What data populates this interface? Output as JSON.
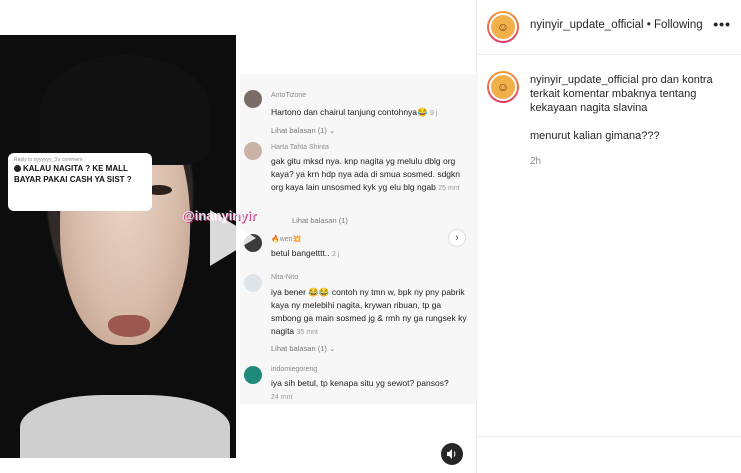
{
  "video": {
    "reply_meta": "Reply to nyyyyyy_3's comment",
    "reply_text": "KALAU NAGITA ? KE MALL BAYAR PAKAI CASH YA SIST ?",
    "watermark": "@inanyinyir"
  },
  "comments": [
    {
      "user": "AntoTizone",
      "text": "Hartono dan chairul tanjung contohnya😂",
      "time": "9 j",
      "link": "Lihat balasan (1)",
      "avatar_color": "#7a6b66"
    },
    {
      "user": "Harta Tahta Shinta",
      "text": "gak gitu mksd nya. knp nagita yg melulu dblg org kaya? ya krn hdp nya ada di smua sosmed. sdgkn org kaya lain unsosmed kyk yg elu blg ngab",
      "time": "25 mnt",
      "link": "",
      "avatar_color": "#c9b3a6"
    },
    {
      "user": "🔥wen💥",
      "text": "betul bangetttt..",
      "time": "2 j",
      "link": "Lihat balasan (1)",
      "avatar_color": "#3b3b3b"
    },
    {
      "user": "Nita-Nito",
      "text": "iya bener 😂😂 contoh ny tmn w, bpk ny pny pabrik kaya ny melebihi nagita, krywan ribuan, tp ga smbong ga main sosmed jg & rmh ny ga rungsek ky nagita",
      "time": "35 mnt",
      "link": "Lihat balasan (1)",
      "avatar_color": "#dfe3ea"
    },
    {
      "user": "indomiegoreng",
      "text": "iya sih betul, tp kenapa situ yg sewot? pansos?",
      "time": "24 mnt",
      "link": "",
      "avatar_color": "#1f8a7a"
    }
  ],
  "header": {
    "username": "nyinyir_update_official",
    "separator": "•",
    "follow_status": "Following",
    "more_label": "•••"
  },
  "caption": {
    "username": "nyinyir_update_official",
    "text": "pro dan kontra terkait komentar mbaknya tentang kekayaan nagita slavina",
    "question": "menurut kalian gimana???",
    "time": "2h"
  },
  "icons": {
    "play": "play-icon",
    "next": "chevron-right-icon",
    "sound": "speaker-icon",
    "more": "more-options-icon"
  }
}
